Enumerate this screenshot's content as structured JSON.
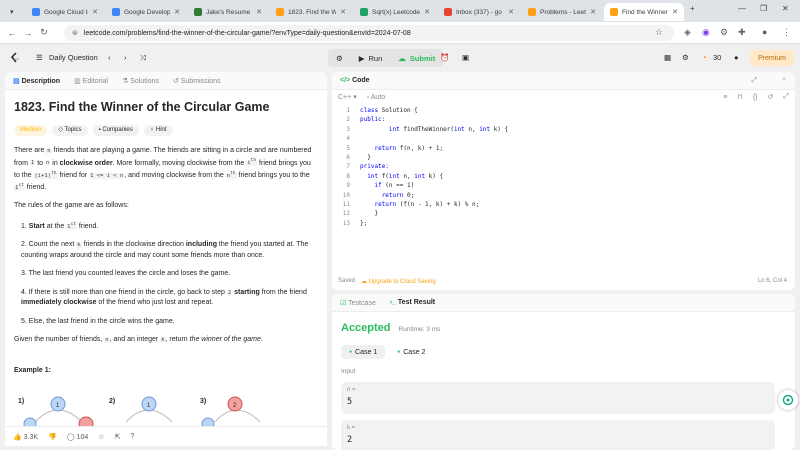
{
  "browser": {
    "tabs": [
      {
        "title": "Google Cloud In",
        "color": "#4285f4"
      },
      {
        "title": "Google Developm",
        "color": "#4285f4"
      },
      {
        "title": "Jake's Resume (a",
        "color": "#2e7d32"
      },
      {
        "title": "1823. Find the W",
        "color": "#ffa116"
      },
      {
        "title": "Sqrt(x) Leetcode",
        "color": "#21a366"
      },
      {
        "title": "Inbox (337) - go",
        "color": "#ea4335"
      },
      {
        "title": "Problems - Leet",
        "color": "#ffa116"
      },
      {
        "title": "Find the Winner",
        "color": "#ffa116"
      }
    ],
    "url": "leetcode.com/problems/find-the-winner-of-the-circular-game/?envType=daily-question&envId=2024-07-08"
  },
  "header": {
    "daily_label": "Daily Question",
    "run_label": "Run",
    "submit_label": "Submit",
    "streak": "30",
    "premium_label": "Premium"
  },
  "left_panel": {
    "tabs": [
      "Description",
      "Editorial",
      "Solutions",
      "Submissions"
    ],
    "title": "1823. Find the Winner of the Circular Game",
    "tags": [
      "Medium",
      "Topics",
      "Companies",
      "Hint"
    ],
    "likes": "3.3K",
    "comments": "104",
    "example_label": "Example 1:",
    "diagram_labels": [
      "1)",
      "2)",
      "3)"
    ]
  },
  "code_panel": {
    "title": "Code",
    "language": "C++",
    "mode": "Auto",
    "lines": [
      "class Solution {",
      "public:",
      "        int findTheWinner(int n, int k) {",
      "",
      "    return f(n, k) + 1;",
      "  }",
      "private:",
      "  int f(int n, int k) {",
      "    if (n == 1)",
      "      return 0;",
      "    return (f(n - 1, k) + k) % n;",
      "    }",
      "};"
    ],
    "saved_label": "Saved",
    "upgrade_label": "Upgrade to Cloud Saving",
    "cursor_pos": "Ln 6, Col 4"
  },
  "result_panel": {
    "tabs": [
      "Testcase",
      "Test Result"
    ],
    "status": "Accepted",
    "runtime": "Runtime: 3 ms",
    "cases": [
      "Case 1",
      "Case 2"
    ],
    "input_label": "Input",
    "inputs": [
      {
        "name": "n =",
        "value": "5"
      },
      {
        "name": "k =",
        "value": "2"
      }
    ]
  },
  "colors": {
    "accent_green": "#2cbb5d",
    "medium": "#ffb800",
    "brand": "#ffa116"
  }
}
